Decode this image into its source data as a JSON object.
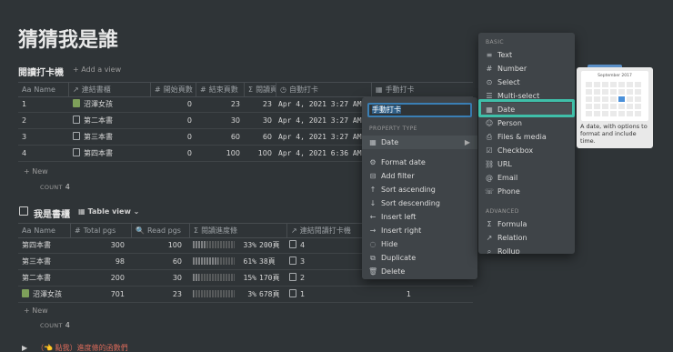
{
  "page_title": "猜猜我是誰",
  "db1": {
    "title": "閱讀打卡機",
    "add_view": "+ Add a view",
    "columns": [
      {
        "icon": "Aa",
        "label": "Name"
      },
      {
        "icon": "↗",
        "label": "連結書櫃"
      },
      {
        "icon": "#",
        "label": "開始頁數"
      },
      {
        "icon": "#",
        "label": "結束頁數"
      },
      {
        "icon": "Σ",
        "label": "閱讀頁數"
      },
      {
        "icon": "◷",
        "label": "自動打卡"
      },
      {
        "icon": "▦",
        "label": "手動打卡"
      }
    ],
    "rows": [
      {
        "name": "1",
        "book": "沼澤女孩",
        "start": "0",
        "end": "23",
        "read": "23",
        "auto": "Apr 4, 2021 3:27 AM"
      },
      {
        "name": "2",
        "book": "第二本書",
        "start": "0",
        "end": "30",
        "read": "30",
        "auto": "Apr 4, 2021 3:27 AM"
      },
      {
        "name": "3",
        "book": "第三本書",
        "start": "0",
        "end": "60",
        "read": "60",
        "auto": "Apr 4, 2021 3:27 AM"
      },
      {
        "name": "4",
        "book": "第四本書",
        "start": "0",
        "end": "100",
        "read": "100",
        "auto": "Apr 4, 2021 6:36 AM"
      }
    ],
    "new": "+ New",
    "count_label": "COUNT",
    "count": "4"
  },
  "db2": {
    "title": "我是書櫃",
    "view": "Table view",
    "columns": [
      {
        "icon": "Aa",
        "label": "Name"
      },
      {
        "icon": "#",
        "label": "Total pgs"
      },
      {
        "icon": "🔍",
        "label": "Read pgs"
      },
      {
        "icon": "Σ",
        "label": "閱讀進度條"
      },
      {
        "icon": "↗",
        "label": "連結閱讀打卡機"
      }
    ],
    "rows": [
      {
        "name": "第四本書",
        "total": "300",
        "read": "100",
        "pct": 0.33,
        "pct_text": "33%",
        "left": "200頁",
        "link": "4"
      },
      {
        "name": "第三本書",
        "total": "98",
        "read": "60",
        "pct": 0.61,
        "pct_text": "61%",
        "left": "38頁",
        "link": "3"
      },
      {
        "name": "第二本書",
        "total": "200",
        "read": "30",
        "pct": 0.15,
        "pct_text": "15%",
        "left": "170頁",
        "link": "2"
      },
      {
        "name": "沼澤女孩",
        "total": "701",
        "read": "23",
        "pct": 0.03,
        "pct_text": "3%",
        "left": "678頁",
        "link": "1",
        "extra": "1"
      }
    ],
    "new": "+ New",
    "count_label": "COUNT",
    "count": "4"
  },
  "toggle_text": "（👈 點我）進度條的函數們",
  "prop_menu": {
    "name_value": "手動打卡",
    "section": "PROPERTY TYPE",
    "type_value": "Date",
    "items": [
      "Format date",
      "Add filter",
      "Sort ascending",
      "Sort descending",
      "Insert left",
      "Insert right",
      "Hide",
      "Duplicate",
      "Delete"
    ]
  },
  "type_menu": {
    "basic_label": "BASIC",
    "basic": [
      "Text",
      "Number",
      "Select",
      "Multi-select",
      "Date",
      "Person",
      "Files & media",
      "Checkbox",
      "URL",
      "Email",
      "Phone"
    ],
    "advanced_label": "ADVANCED",
    "advanced": [
      "Formula",
      "Relation",
      "Rollup"
    ]
  },
  "tooltip": {
    "month": "September 2017",
    "text": "A date, with options to format and include time."
  },
  "colors": {
    "accent": "#3fbfa9",
    "bg": "#2f3437",
    "menu": "#3f4448"
  }
}
